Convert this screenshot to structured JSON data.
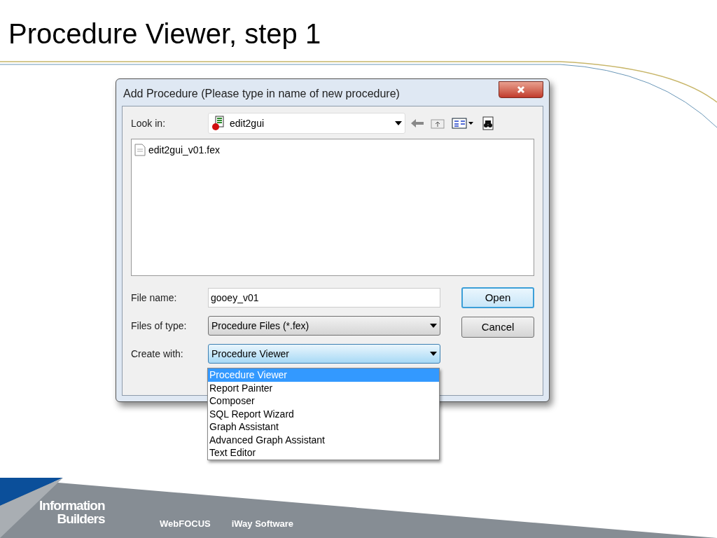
{
  "slide_title": "Procedure Viewer, step 1",
  "dialog": {
    "title": "Add Procedure (Please type in name of new procedure)",
    "look_in": {
      "label": "Look in:",
      "value": "edit2gui"
    },
    "files": [
      {
        "name": "edit2gui_v01.fex"
      }
    ],
    "file_name": {
      "label": "File name:",
      "value": "gooey_v01"
    },
    "files_of_type": {
      "label": "Files of type:",
      "value": "Procedure Files (*.fex)"
    },
    "create_with": {
      "label": "Create with:",
      "value": "Procedure Viewer",
      "expanded": true,
      "options": [
        {
          "label": "Procedure Viewer",
          "selected": true
        },
        {
          "label": "Report Painter",
          "selected": false
        },
        {
          "label": "Composer",
          "selected": false
        },
        {
          "label": "SQL Report Wizard",
          "selected": false
        },
        {
          "label": "Graph Assistant",
          "selected": false
        },
        {
          "label": "Advanced Graph Assistant",
          "selected": false
        },
        {
          "label": "Text Editor",
          "selected": false
        }
      ]
    },
    "buttons": [
      {
        "label": "Open",
        "default": true
      },
      {
        "label": "Cancel",
        "default": false
      }
    ]
  },
  "footer": {
    "logo_lines": [
      "Information",
      "Builders"
    ],
    "links": [
      "WebFOCUS",
      "iWay Software"
    ]
  }
}
